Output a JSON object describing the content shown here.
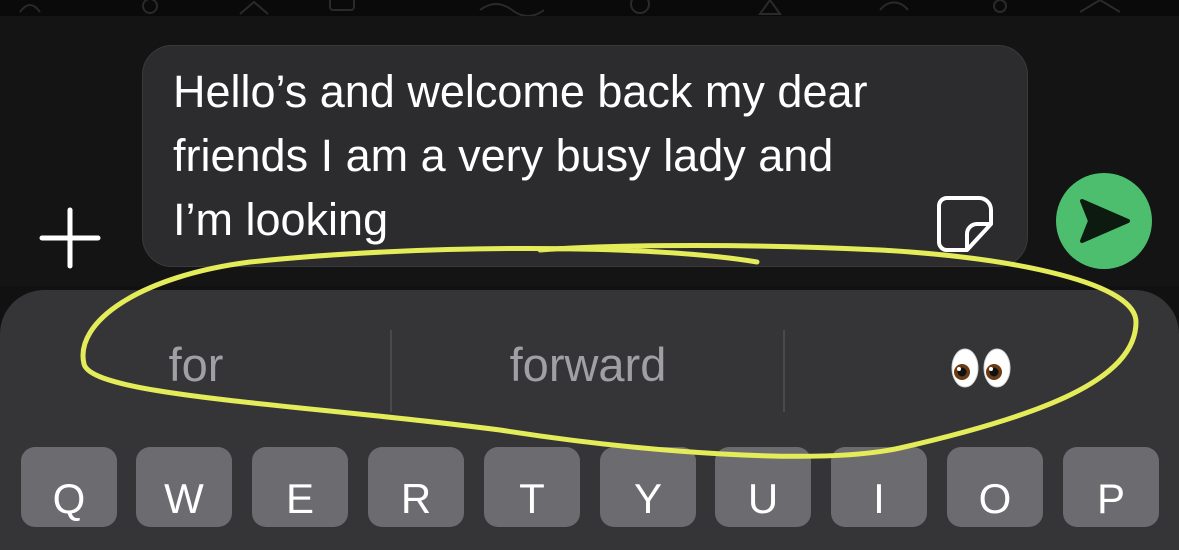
{
  "composer": {
    "message_text": "Hello’s and welcome back my dear friends I am a very busy lady and I’m looking"
  },
  "suggestions": {
    "items": [
      {
        "label": "for"
      },
      {
        "label": "forward"
      },
      {
        "label": "👀",
        "icon": "eyes-emoji"
      }
    ]
  },
  "keyboard": {
    "keys": [
      "Q",
      "W",
      "E",
      "R",
      "T",
      "Y",
      "U",
      "I",
      "O",
      "P"
    ]
  },
  "colors": {
    "send_button": "#4cbe6e",
    "highlight_stroke": "#e4ec5a",
    "field_background": "#2c2c2e"
  },
  "icons": [
    "plus-icon",
    "sticker-icon",
    "send-arrow-icon",
    "eyes-emoji"
  ]
}
